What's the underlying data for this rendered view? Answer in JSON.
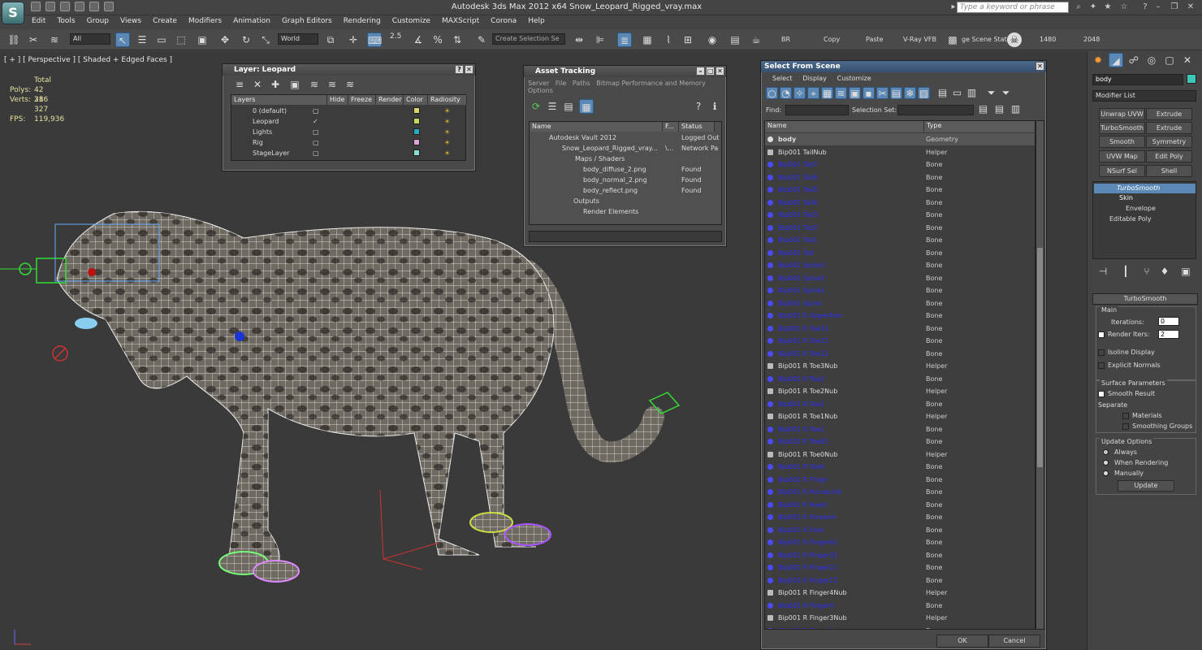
{
  "app": {
    "title": "Autodesk 3ds Max  2012 x64    Snow_Leopard_Rigged_vray.max",
    "logo": "S",
    "search_placeholder": "Type a keyword or phrase"
  },
  "menu": [
    "Edit",
    "Tools",
    "Group",
    "Views",
    "Create",
    "Modifiers",
    "Animation",
    "Graph Editors",
    "Rendering",
    "Customize",
    "MAXScript",
    "Corona",
    "Help"
  ],
  "toolbar": {
    "filter": "All",
    "coord": "World",
    "snap": "2.5",
    "named_sel": "Create Selection Se",
    "br": "BR",
    "copy": "Copy",
    "paste": "Paste",
    "vfb": "V-Ray VFB",
    "scene_stat": "ge Scene Stat",
    "w": "1480",
    "h": "2048"
  },
  "viewport": {
    "label": "[ + ] [ Perspective ] [ Shaded + Edged Faces ]",
    "total": "Total",
    "polys_label": "Polys:",
    "polys": "42 386",
    "verts_label": "Verts:",
    "verts": "21 327",
    "fps_label": "FPS:",
    "fps": "119,936"
  },
  "layer_win": {
    "title": "Layer: Leopard",
    "cols": [
      "Layers",
      "Hide",
      "Freeze",
      "Render",
      "Color",
      "Radiosity"
    ],
    "rows": [
      {
        "name": "0 (default)",
        "color": "#d8d86a"
      },
      {
        "name": "Leopard",
        "color": "#c8d85a"
      },
      {
        "name": "Lights",
        "color": "#2aa8c0"
      },
      {
        "name": "Rig",
        "color": "#e0a0d8"
      },
      {
        "name": "StageLayer",
        "color": "#8ae0d0"
      }
    ]
  },
  "asset_win": {
    "title": "Asset Tracking",
    "menu": [
      "Server",
      "File",
      "Paths",
      "Bitmap Performance and Memory"
    ],
    "options": "Options",
    "cols": [
      "Name",
      "F...",
      "Status"
    ],
    "rows": [
      {
        "name": "Autodesk Vault 2012",
        "f": "",
        "status": "Logged Out"
      },
      {
        "name": "Snow_Leopard_Rigged_vray...",
        "f": "\\...",
        "status": "Network Pa"
      },
      {
        "name": "Maps / Shaders",
        "f": "",
        "status": ""
      },
      {
        "name": "body_diffuse_2.png",
        "f": "",
        "status": "Found"
      },
      {
        "name": "body_normal_2.png",
        "f": "",
        "status": "Found"
      },
      {
        "name": "body_reflect.png",
        "f": "",
        "status": "Found"
      },
      {
        "name": "Outputs",
        "f": "",
        "status": ""
      },
      {
        "name": "Render Elements",
        "f": "",
        "status": ""
      }
    ]
  },
  "select_win": {
    "title": "Select From Scene",
    "menu": [
      "Select",
      "Display",
      "Customize"
    ],
    "find_label": "Find:",
    "selset_label": "Selection Set:",
    "col_name": "Name",
    "col_type": "Type",
    "ok": "OK",
    "cancel": "Cancel",
    "rows": [
      {
        "n": "body",
        "t": "Geometry",
        "k": "geom"
      },
      {
        "n": "Bip001 TailNub",
        "t": "Helper",
        "k": "helper"
      },
      {
        "n": "Bip001 Tail7",
        "t": "Bone",
        "k": "bone"
      },
      {
        "n": "Bip001 Tail6",
        "t": "Bone",
        "k": "bone"
      },
      {
        "n": "Bip001 Tail5",
        "t": "Bone",
        "k": "bone"
      },
      {
        "n": "Bip001 Tail4",
        "t": "Bone",
        "k": "bone"
      },
      {
        "n": "Bip001 Tail3",
        "t": "Bone",
        "k": "bone"
      },
      {
        "n": "Bip001 Tail2",
        "t": "Bone",
        "k": "bone"
      },
      {
        "n": "Bip001 Tail1",
        "t": "Bone",
        "k": "bone"
      },
      {
        "n": "Bip001 Tail",
        "t": "Bone",
        "k": "bone"
      },
      {
        "n": "Bip001 Spine3",
        "t": "Bone",
        "k": "bone"
      },
      {
        "n": "Bip001 Spine2",
        "t": "Bone",
        "k": "bone"
      },
      {
        "n": "Bip001 Spine1",
        "t": "Bone",
        "k": "bone"
      },
      {
        "n": "Bip001 Spine",
        "t": "Bone",
        "k": "bone"
      },
      {
        "n": "Bip001 R UpperArm",
        "t": "Bone",
        "k": "bone"
      },
      {
        "n": "Bip001 R Toe31",
        "t": "Bone",
        "k": "bone"
      },
      {
        "n": "Bip001 R Toe21",
        "t": "Bone",
        "k": "bone"
      },
      {
        "n": "Bip001 R Toe11",
        "t": "Bone",
        "k": "bone"
      },
      {
        "n": "Bip001 R Toe3Nub",
        "t": "Helper",
        "k": "helper"
      },
      {
        "n": "Bip001 R Toe3",
        "t": "Bone",
        "k": "bone"
      },
      {
        "n": "Bip001 R Toe2Nub",
        "t": "Helper",
        "k": "helper"
      },
      {
        "n": "Bip001 R Toe2",
        "t": "Bone",
        "k": "bone"
      },
      {
        "n": "Bip001 R Toe1Nub",
        "t": "Helper",
        "k": "helper"
      },
      {
        "n": "Bip001 R Toe1",
        "t": "Bone",
        "k": "bone"
      },
      {
        "n": "Bip001 R Toe01",
        "t": "Bone",
        "k": "bone"
      },
      {
        "n": "Bip001 R Toe0Nub",
        "t": "Helper",
        "k": "helper"
      },
      {
        "n": "Bip001 R Toe0",
        "t": "Bone",
        "k": "bone"
      },
      {
        "n": "Bip001 R Thigh",
        "t": "Bone",
        "k": "bone"
      },
      {
        "n": "Bip001 R HorseLink",
        "t": "Bone",
        "k": "bone"
      },
      {
        "n": "Bip001 R Hand",
        "t": "Bone",
        "k": "bone"
      },
      {
        "n": "Bip001 R Forearm",
        "t": "Bone",
        "k": "bone"
      },
      {
        "n": "Bip001 R Foot",
        "t": "Bone",
        "k": "bone"
      },
      {
        "n": "Bip001 R Finger41",
        "t": "Bone",
        "k": "bone"
      },
      {
        "n": "Bip001 R Finger31",
        "t": "Bone",
        "k": "bone"
      },
      {
        "n": "Bip001 R Finger21",
        "t": "Bone",
        "k": "bone"
      },
      {
        "n": "Bip001 R Finger11",
        "t": "Bone",
        "k": "bone"
      },
      {
        "n": "Bip001 R Finger4Nub",
        "t": "Helper",
        "k": "helper"
      },
      {
        "n": "Bip001 R Finger4",
        "t": "Bone",
        "k": "bone"
      },
      {
        "n": "Bip001 R Finger3Nub",
        "t": "Helper",
        "k": "helper"
      },
      {
        "n": "Bip001 R Finger3",
        "t": "Bone",
        "k": "bone"
      }
    ]
  },
  "cmd": {
    "object_name": "body",
    "modifier_list": "Modifier List",
    "buttons": [
      "Unwrap UVW",
      "Extrude",
      "TurboSmooth",
      "Extrude",
      "Smooth",
      "Symmetry",
      "UVW Map",
      "Edit Poly",
      "NSurf Sel",
      "Shell"
    ],
    "stack": [
      "TurboSmooth",
      "Skin",
      "Envelope",
      "Editable Poly"
    ],
    "rollout": "TurboSmooth",
    "main": "Main",
    "iterations_label": "Iterations:",
    "iterations": "0",
    "render_iters_label": "Render Iters:",
    "render_iters": "2",
    "isoline": "Isoline Display",
    "explicit": "Explicit Normals",
    "surface": "Surface Parameters",
    "smooth_result": "Smooth Result",
    "separate": "Separate",
    "materials": "Materials",
    "smoothing_groups": "Smoothing Groups",
    "update_options": "Update Options",
    "always": "Always",
    "when_rendering": "When Rendering",
    "manually": "Manually",
    "update": "Update"
  }
}
